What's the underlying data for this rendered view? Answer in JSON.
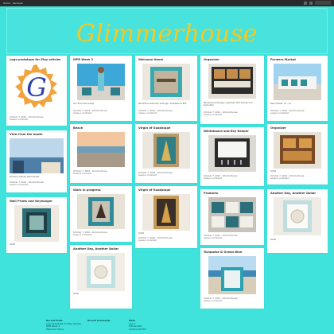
{
  "topbar": {
    "links": [
      "Home",
      "Services"
    ],
    "search_placeholder": ""
  },
  "site": {
    "title": "Glimmerhouse",
    "title_color": "#f7c81e",
    "background": "#3fe3dc"
  },
  "posts": [
    {
      "title": "Logo prototype for Etsy aritcles",
      "excerpt": "",
      "date": "October 7, 2016",
      "author": "Glimmerhouse",
      "comment": "Leave a comment",
      "img": "logo"
    },
    {
      "title": "MPR Week 2",
      "excerpt": "Our first show setup",
      "date": "October 7, 2016",
      "author": "Glimmerhouse",
      "comment": "Leave a comment",
      "img": "market"
    },
    {
      "title": "Welcome Home",
      "excerpt": "Reclaimed welcome mat sign. Available at BLS",
      "date": "October 7, 2016",
      "author": "Glimmerhouse",
      "comment": "Leave a comment",
      "img": "welcome"
    },
    {
      "title": "Organizer",
      "excerpt": "Reclaimed entryway organizer with frames and keyholder",
      "date": "October 7, 2016",
      "author": "Glimmerhouse",
      "comment": "Leave a comment",
      "img": "organizer"
    },
    {
      "title": "Farmers Market",
      "excerpt": "Pearl Street, 10 - 12",
      "date": "October 7, 2016",
      "author": "Glimmerhouse",
      "comment": "Leave a comment",
      "img": "farmers"
    },
    {
      "title": "View from the booth",
      "excerpt": "Farmers market, Pearl Street",
      "date": "October 7, 2016",
      "author": "Glimmerhouse",
      "comment": "Leave a comment",
      "img": "booth"
    },
    {
      "title": "Beach",
      "excerpt": "",
      "date": "October 7, 2016",
      "author": "Glimmerhouse",
      "comment": "Leave a comment",
      "img": "beach"
    },
    {
      "title": "Virgin of Guadalupe",
      "excerpt": "",
      "date": "October 7, 2016",
      "author": "Glimmerhouse",
      "comment": "Leave a comment",
      "img": "virgin1"
    },
    {
      "title": "Whiteboard and Key Keeper",
      "excerpt": "",
      "date": "October 7, 2016",
      "author": "Glimmerhouse",
      "comment": "Leave a comment",
      "img": "whiteboard"
    },
    {
      "title": "Organizer",
      "excerpt": "SOLD",
      "date": "October 7, 2016",
      "author": "Glimmerhouse",
      "comment": "Leave a comment",
      "img": "organizer2"
    },
    {
      "title": "Wall Prints and Keyhanger",
      "excerpt": "SOLD",
      "date": "October 7, 2016",
      "author": "Glimmerhouse",
      "comment": "Leave a comment",
      "img": "wallprint"
    },
    {
      "title": "Work in progress",
      "excerpt": "",
      "date": "October 7, 2016",
      "author": "Glimmerhouse",
      "comment": "Leave a comment",
      "img": "wip"
    },
    {
      "title": "Virgin of Guadalupe",
      "excerpt": "SOLD",
      "date": "October 7, 2016",
      "author": "Glimmerhouse",
      "comment": "Leave a comment",
      "img": "virgin2"
    },
    {
      "title": "Products",
      "excerpt": "",
      "date": "October 7, 2016",
      "author": "Glimmerhouse",
      "comment": "Leave a comment",
      "img": "products"
    },
    {
      "title": "Another Day, Another Dollar",
      "excerpt": "SOLD",
      "date": "October 7, 2016",
      "author": "Glimmerhouse",
      "comment": "Leave a comment",
      "img": "dollar1"
    },
    {
      "title": "Another Day, Another Dollar",
      "excerpt": "SOLD",
      "date": "October 7, 2016",
      "author": "Glimmerhouse",
      "comment": "Leave a comment",
      "img": "dollar2"
    },
    {
      "title": "Turquoise & Ocean Blue",
      "excerpt": "",
      "date": "October 7, 2016",
      "author": "Glimmerhouse",
      "comment": "Leave a comment",
      "img": "turquoise"
    }
  ],
  "footer": {
    "recent_posts_title": "Recent Posts",
    "recent_posts": [
      "Logo prototype for Etsy aritcles",
      "MPR Week 2",
      "Welcome Home"
    ],
    "recent_comments_title": "Recent Comments",
    "meta_title": "Meta",
    "meta_links": [
      "Log in",
      "Entries RSS",
      "Comments RSS"
    ]
  }
}
